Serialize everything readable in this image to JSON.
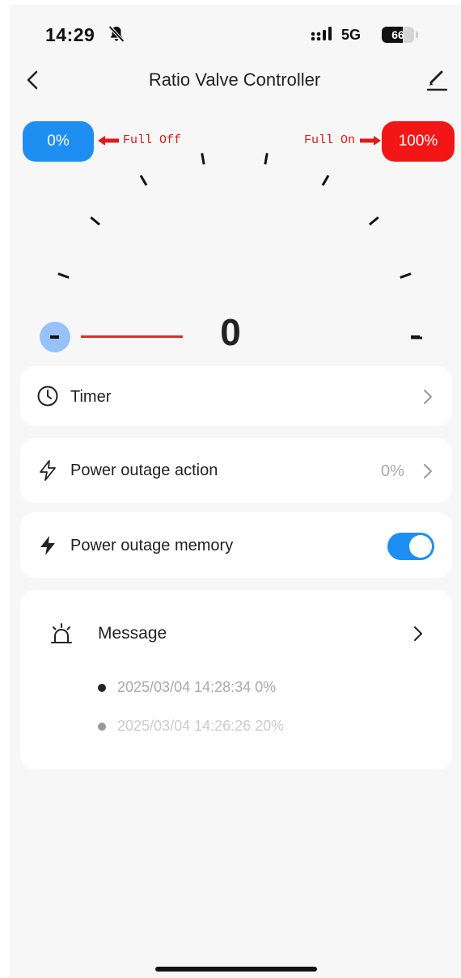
{
  "status_bar": {
    "time": "14:29",
    "network": "5G",
    "battery": "66",
    "battery_level": 0.66,
    "icons": [
      "bell-slash-icon",
      "signal-icon",
      "battery-icon"
    ]
  },
  "nav": {
    "title": "Ratio Valve Controller",
    "icons": [
      "back-icon",
      "edit-icon"
    ]
  },
  "dial": {
    "min_label": "0%",
    "max_label": "100%",
    "min_caption": "Full Off",
    "max_caption": "Full On",
    "value": "0",
    "decrement_label": "-",
    "increment_label": "-",
    "colors": {
      "min": "#1e8ff2",
      "max": "#f21616",
      "indicator": "#e02b2b"
    }
  },
  "timer": {
    "label": "Timer",
    "icon": "clock-icon"
  },
  "power_outage_action": {
    "label": "Power outage action",
    "value": "0%",
    "icon": "lightning-outline-icon"
  },
  "power_outage_memory": {
    "label": "Power outage memory",
    "enabled": true,
    "icon": "lightning-filled-icon"
  },
  "message": {
    "title": "Message",
    "icon": "alarm-icon",
    "entries": [
      {
        "text": "2025/03/04 14:28:34 0%"
      },
      {
        "text": "2025/03/04 14:26:26 20%"
      }
    ]
  }
}
